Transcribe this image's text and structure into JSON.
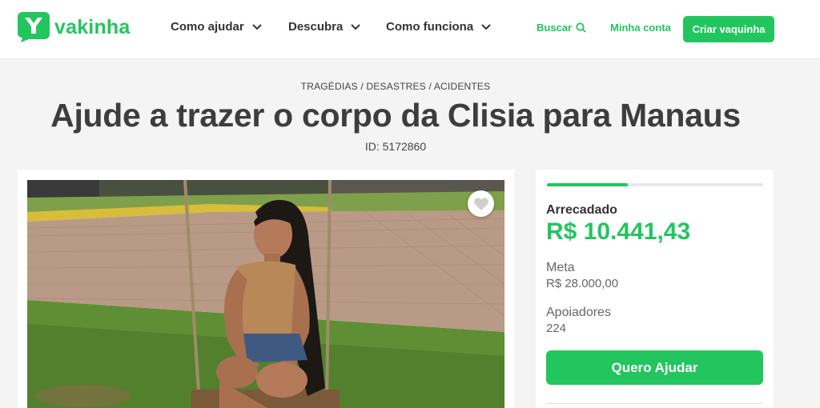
{
  "header": {
    "logo_text": "vakinha",
    "nav": [
      {
        "label": "Como ajudar"
      },
      {
        "label": "Descubra"
      },
      {
        "label": "Como funciona"
      }
    ],
    "search_label": "Buscar",
    "account_label": "Minha conta",
    "create_label": "Criar vaquinha"
  },
  "campaign": {
    "category": "TRAGÉDIAS / DESASTRES / ACIDENTES",
    "title": "Ajude a trazer o corpo da Clisia para Manaus",
    "id_text": "ID: 5172860"
  },
  "stats": {
    "progress": 0.373,
    "raised_label": "Arrecadado",
    "raised_value": "R$ 10.441,43",
    "goal_label": "Meta",
    "goal_value": "R$ 28.000,00",
    "supporters_label": "Apoiadores",
    "supporters_value": "224",
    "cta_label": "Quero Ajudar"
  },
  "colors": {
    "brand": "#23c55e",
    "background": "#f4f4f4",
    "text": "#3d3d3d"
  },
  "icons": [
    "logo-icon",
    "chevron-down-icon",
    "search-icon",
    "heart-icon"
  ]
}
